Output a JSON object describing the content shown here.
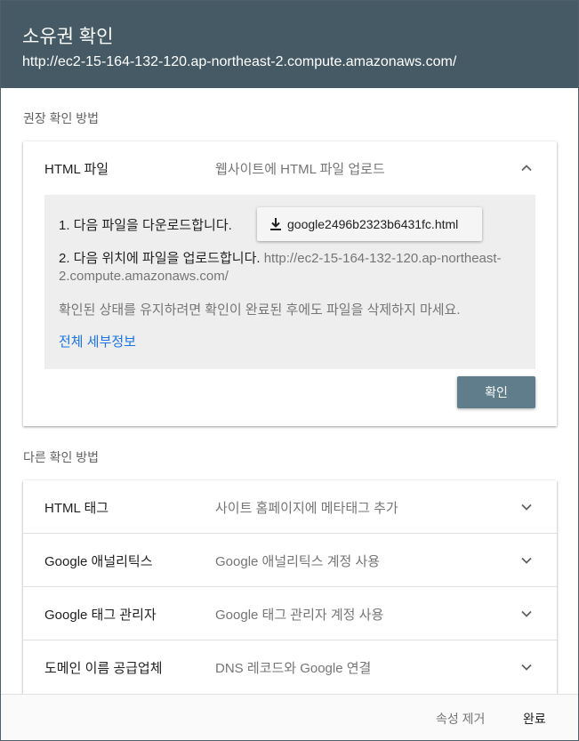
{
  "header": {
    "title": "소유권 확인",
    "subtitle": "http://ec2-15-164-132-120.ap-northeast-2.compute.amazonaws.com/"
  },
  "recommended": {
    "section_label": "권장 확인 방법",
    "method_name": "HTML 파일",
    "method_desc": "웹사이트에 HTML 파일 업로드",
    "step1": "1. 다음 파일을 다운로드합니다.",
    "download_file": "google2496b2323b6431fc.html",
    "step2_text": "2. 다음 위치에 파일을 업로드합니다. ",
    "step2_url": "http://ec2-15-164-132-120.ap-northeast-2.compute.amazonaws.com/",
    "note": "확인된 상태를 유지하려면 확인이 완료된 후에도 파일을 삭제하지 마세요.",
    "details_link": "전체 세부정보",
    "verify_button": "확인"
  },
  "other": {
    "section_label": "다른 확인 방법",
    "methods": [
      {
        "name": "HTML 태그",
        "desc": "사이트 홈페이지에 메타태그 추가"
      },
      {
        "name": "Google 애널리틱스",
        "desc": "Google 애널리틱스 계정 사용"
      },
      {
        "name": "Google 태그 관리자",
        "desc": "Google 태그 관리자 계정 사용"
      },
      {
        "name": "도메인 이름 공급업체",
        "desc": "DNS 레코드와 Google 연결"
      }
    ]
  },
  "footer": {
    "remove_button": "속성 제거",
    "done_button": "완료"
  },
  "icons": {
    "download": "download-icon",
    "expand": "chevron-down-icon",
    "collapse": "chevron-up-icon"
  },
  "colors": {
    "header_bg": "#455a64",
    "verify_button_bg": "#607d8b",
    "link": "#1a73e8"
  }
}
